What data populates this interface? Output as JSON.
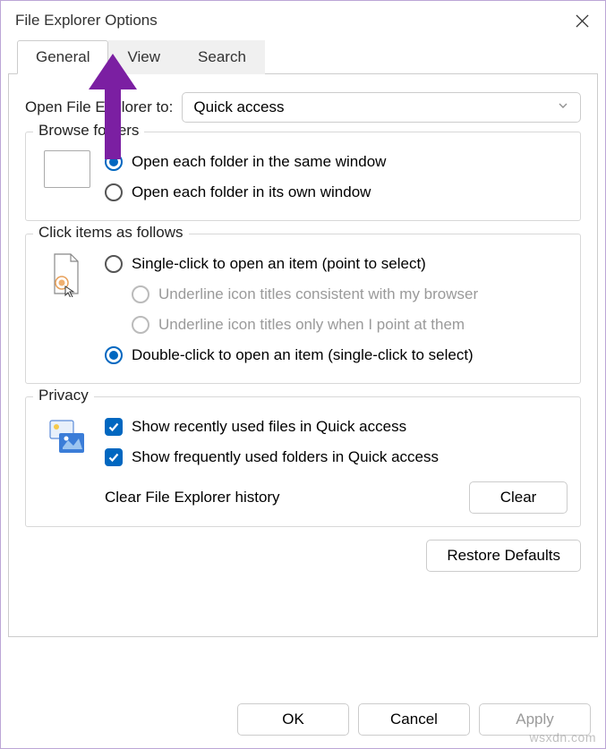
{
  "window": {
    "title": "File Explorer Options"
  },
  "tabs": {
    "general": "General",
    "view": "View",
    "search": "Search"
  },
  "open_to": {
    "label": "Open File Explorer to:",
    "value": "Quick access"
  },
  "browse_folders": {
    "legend": "Browse folders",
    "opt_same": "Open each folder in the same window",
    "opt_own": "Open each folder in its own window"
  },
  "click_items": {
    "legend": "Click items as follows",
    "opt_single": "Single-click to open an item (point to select)",
    "opt_underline_browser": "Underline icon titles consistent with my browser",
    "opt_underline_point": "Underline icon titles only when I point at them",
    "opt_double": "Double-click to open an item (single-click to select)"
  },
  "privacy": {
    "legend": "Privacy",
    "chk_recent": "Show recently used files in Quick access",
    "chk_frequent": "Show frequently used folders in Quick access",
    "clear_label": "Clear File Explorer history",
    "clear_btn": "Clear"
  },
  "restore_btn": "Restore Defaults",
  "footer": {
    "ok": "OK",
    "cancel": "Cancel",
    "apply": "Apply"
  },
  "watermark": "wsxdn.com"
}
